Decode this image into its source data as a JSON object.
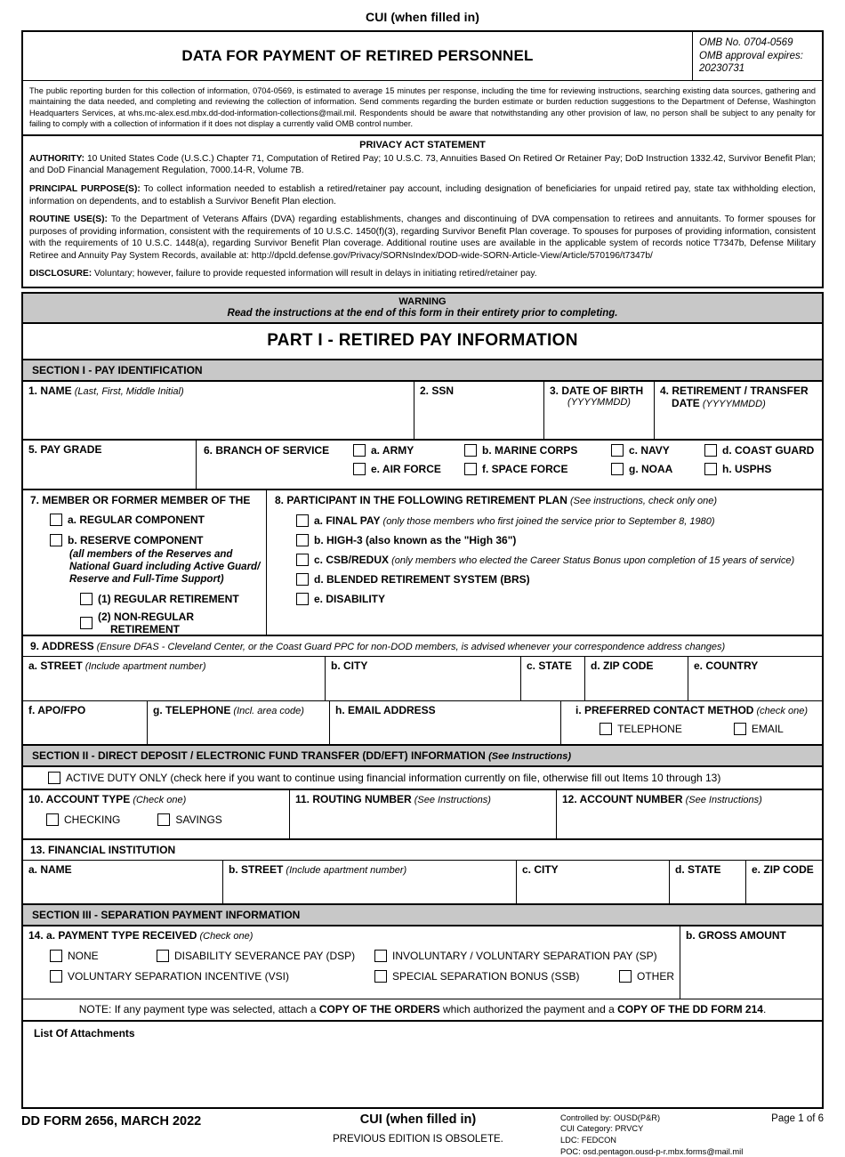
{
  "header": {
    "cui_top": "CUI (when filled in)",
    "form_title": "DATA FOR PAYMENT OF RETIRED PERSONNEL",
    "omb_no": "OMB No. 0704-0569",
    "omb_expires_label": "OMB approval expires:",
    "omb_expires_value": "20230731"
  },
  "burden": "The public reporting burden for this collection of information, 0704-0569, is estimated to average 15 minutes per response, including the time for reviewing instructions, searching existing data sources, gathering and maintaining the data needed, and completing and reviewing the collection of information. Send comments regarding the burden estimate or burden reduction suggestions to the Department of Defense, Washington Headquarters Services, at whs.mc-alex.esd.mbx.dd-dod-information-collections@mail.mil. Respondents should be aware that notwithstanding any other provision of law, no person shall be subject to any penalty for failing to comply with a collection of information if it does not display a currently valid OMB control number.",
  "privacy": {
    "title": "PRIVACY ACT STATEMENT",
    "authority_label": "AUTHORITY:",
    "authority_text": " 10 United States Code (U.S.C.) Chapter 71, Computation of Retired Pay; 10 U.S.C. 73, Annuities Based On Retired Or Retainer Pay; DoD Instruction 1332.42, Survivor Benefit Plan; and DoD Financial Management Regulation, 7000.14-R, Volume 7B.",
    "purpose_label": "PRINCIPAL PURPOSE(S):",
    "purpose_text": " To collect information needed to establish a retired/retainer pay account, including designation of beneficiaries for unpaid retired pay, state tax withholding election, information on dependents, and to establish a Survivor Benefit Plan election.",
    "routine_label": "ROUTINE USE(S):",
    "routine_text": " To the Department of Veterans Affairs (DVA) regarding establishments, changes and discontinuing of DVA compensation to retirees and annuitants. To former spouses for purposes of providing information, consistent with the requirements of 10 U.S.C. 1450(f)(3), regarding Survivor Benefit Plan coverage. To spouses for purposes of providing information, consistent with the requirements of 10 U.S.C. 1448(a), regarding Survivor Benefit Plan coverage.  Additional routine uses are available in the applicable system of records notice T7347b, Defense Military Retiree and Annuity Pay System Records, available at: http://dpcld.defense.gov/Privacy/SORNsIndex/DOD-wide-SORN-Article-View/Article/570196/t7347b/",
    "disclosure_label": "DISCLOSURE:",
    "disclosure_text": " Voluntary; however, failure to provide requested information will result in delays in initiating retired/retainer pay."
  },
  "warning": {
    "title": "WARNING",
    "text": "Read the instructions at the end of this form in their entirety prior to completing."
  },
  "part1": {
    "banner": "PART I - RETIRED PAY INFORMATION",
    "section1": "SECTION I - PAY IDENTIFICATION"
  },
  "item1": {
    "label": "1. NAME",
    "hint": "(Last, First, Middle Initial)"
  },
  "item2": {
    "label": "2. SSN"
  },
  "item3": {
    "label": "3. DATE OF BIRTH",
    "hint": "(YYYYMMDD)"
  },
  "item4": {
    "label": "4. RETIREMENT / TRANSFER",
    "label2": "DATE",
    "hint": "(YYYYMMDD)"
  },
  "item5": {
    "label": "5. PAY GRADE"
  },
  "item6": {
    "label": "6. BRANCH OF SERVICE",
    "options_row1": [
      "a. ARMY",
      "b. MARINE CORPS",
      "c. NAVY",
      "d. COAST GUARD"
    ],
    "options_row2": [
      "e. AIR FORCE",
      "f. SPACE FORCE",
      "g. NOAA",
      "h. USPHS"
    ]
  },
  "item7": {
    "label": "7. MEMBER OR FORMER MEMBER OF THE",
    "opt_a": "a. REGULAR COMPONENT",
    "opt_b": "b. RESERVE COMPONENT",
    "note": "(all members of the Reserves and National Guard including Active Guard/ Reserve and Full-Time Support)",
    "sub1": "(1) REGULAR RETIREMENT",
    "sub2a": "(2) NON-REGULAR",
    "sub2b": "RETIREMENT"
  },
  "item8": {
    "label": "8. PARTICIPANT IN THE FOLLOWING RETIREMENT PLAN",
    "hint": "(See instructions, check only one)",
    "options": [
      {
        "bold": "a. FINAL PAY",
        "ital": " (only those members who first joined the service prior to September 8, 1980)"
      },
      {
        "bold": "b. HIGH-3 (also known as the \"High 36\")",
        "ital": ""
      },
      {
        "bold": "c. CSB/REDUX",
        "ital": " (only members who elected the Career Status Bonus upon completion of 15 years of service)"
      },
      {
        "bold": "d. BLENDED RETIREMENT SYSTEM (BRS)",
        "ital": ""
      },
      {
        "bold": "e. DISABILITY",
        "ital": ""
      }
    ]
  },
  "item9": {
    "label": "9. ADDRESS",
    "hint": "(Ensure DFAS - Cleveland Center, or the Coast Guard PPC for non-DOD members, is advised whenever your correspondence address changes)",
    "street_label": "a. STREET",
    "street_hint": "(Include apartment number)",
    "city_label": "b. CITY",
    "state_label": "c. STATE",
    "zip_label": "d. ZIP CODE",
    "country_label": "e. COUNTRY",
    "apofpo_label": "f. APO/FPO",
    "tel_label": "g. TELEPHONE",
    "tel_hint": "(Incl. area code)",
    "email_label": "h. EMAIL ADDRESS",
    "contact_label": "i. PREFERRED CONTACT METHOD",
    "contact_hint": "(check one)",
    "contact_opt1": "TELEPHONE",
    "contact_opt2": "EMAIL"
  },
  "section2": {
    "banner": "SECTION II - DIRECT DEPOSIT / ELECTRONIC FUND TRANSFER (DD/EFT) INFORMATION",
    "banner_note": "(See Instructions)",
    "active_duty": "ACTIVE DUTY ONLY (check here if you want to continue using financial information currently on file, otherwise fill out Items 10 through 13)"
  },
  "item10": {
    "label": "10. ACCOUNT TYPE",
    "hint": "(Check one)",
    "opt1": "CHECKING",
    "opt2": "SAVINGS"
  },
  "item11": {
    "label": "11. ROUTING NUMBER",
    "hint": "(See Instructions)"
  },
  "item12": {
    "label": "12. ACCOUNT NUMBER",
    "hint": "(See Instructions)"
  },
  "item13": {
    "label": "13. FINANCIAL INSTITUTION",
    "name_label": "a. NAME",
    "street_label": "b. STREET",
    "street_hint": "(Include apartment number)",
    "city_label": "c. CITY",
    "state_label": "d. STATE",
    "zip_label": "e. ZIP CODE"
  },
  "section3": {
    "banner": "SECTION III - SEPARATION PAYMENT INFORMATION"
  },
  "item14": {
    "label": "14. a. PAYMENT TYPE RECEIVED",
    "hint": "(Check one)",
    "row1": [
      "NONE",
      "DISABILITY SEVERANCE PAY (DSP)",
      "INVOLUNTARY / VOLUNTARY SEPARATION PAY (SP)"
    ],
    "row2": [
      "VOLUNTARY SEPARATION INCENTIVE (VSI)",
      "SPECIAL SEPARATION BONUS (SSB)",
      "OTHER"
    ],
    "gross_label": "b. GROSS AMOUNT",
    "note_pre": "NOTE: If any payment type was selected, attach a ",
    "note_b1": "COPY OF THE ORDERS",
    "note_mid": " which authorized the payment and a ",
    "note_b2": "COPY OF THE DD FORM 214",
    "note_end": "."
  },
  "attachments": {
    "label": "List Of Attachments"
  },
  "footer": {
    "form_id": "DD FORM 2656, MARCH 2022",
    "cui": "CUI (when filled in)",
    "previous": "PREVIOUS EDITION IS OBSOLETE.",
    "controlled_by": "Controlled by: OUSD(P&R)",
    "cui_category": "CUI Category: PRVCY",
    "ldc": "LDC: FEDCON",
    "poc": "POC: osd.pentagon.ousd-p-r.mbx.forms@mail.mil",
    "page": "Page 1 of 6"
  },
  "colors": {
    "banner_gray": "#c8c8c8",
    "ink": "#000000",
    "paper": "#ffffff"
  }
}
